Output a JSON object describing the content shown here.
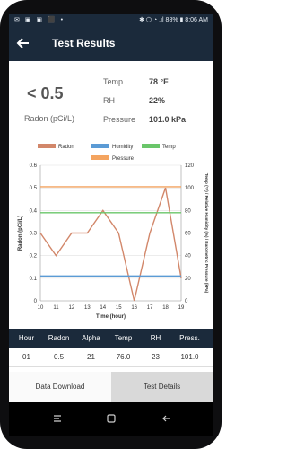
{
  "status_bar": {
    "left_icons": "✉ ▣ ▣ ⬛ •",
    "right_text": "✱ ⬡ ◔ .ıl 88% ▮ 8:06 AM"
  },
  "app_bar": {
    "back_icon": "back-arrow-icon",
    "title": "Test Results"
  },
  "summary": {
    "reading": "< 0.5",
    "unit": "Radon (pCi/L)",
    "metrics": [
      {
        "label": "Temp",
        "value": "78 °F"
      },
      {
        "label": "RH",
        "value": "22%"
      },
      {
        "label": "Pressure",
        "value": "101.0 kPa"
      }
    ]
  },
  "chart_data": {
    "type": "line",
    "legend": [
      {
        "name": "Radon",
        "color": "#d2876a"
      },
      {
        "name": "Humidity",
        "color": "#5b9bd5"
      },
      {
        "name": "Temp",
        "color": "#6ac66a"
      },
      {
        "name": "Pressure",
        "color": "#f4a460"
      }
    ],
    "x": [
      10,
      11,
      12,
      13,
      14,
      15,
      16,
      17,
      18,
      19
    ],
    "xlabel": "Time (hour)",
    "ylabel_left": "Radon (pCi/L)",
    "ylabel_right": "Temp (°F) / Relative Humidity (%) / Barometric Pressure (kPa)",
    "ylim_left": [
      0,
      0.6
    ],
    "ylim_right": [
      0,
      120
    ],
    "yticks_left": [
      "0",
      "0.1",
      "0.2",
      "0.3",
      "0.4",
      "0.5",
      "0.6"
    ],
    "yticks_right": [
      "0",
      "20",
      "40",
      "60",
      "80",
      "100",
      "120"
    ],
    "series": [
      {
        "name": "Radon",
        "axis": "left",
        "color": "#d2876a",
        "values": [
          0.3,
          0.2,
          0.3,
          0.3,
          0.4,
          0.3,
          0.0,
          0.3,
          0.5,
          0.1
        ]
      },
      {
        "name": "Humidity",
        "axis": "right",
        "color": "#5b9bd5",
        "values": [
          22,
          22,
          22,
          22,
          22,
          22,
          22,
          22,
          22,
          22
        ]
      },
      {
        "name": "Temp",
        "axis": "right",
        "color": "#6ac66a",
        "values": [
          78,
          78,
          78,
          78,
          78,
          78,
          78,
          78,
          78,
          78
        ]
      },
      {
        "name": "Pressure",
        "axis": "right",
        "color": "#f4a460",
        "values": [
          101,
          101,
          101,
          101,
          101,
          101,
          101,
          101,
          101,
          101
        ]
      }
    ]
  },
  "table": {
    "headers": [
      "Hour",
      "Radon",
      "Alpha",
      "Temp",
      "RH",
      "Press."
    ],
    "row": [
      "01",
      "0.5",
      "21",
      "76.0",
      "23",
      "101.0"
    ]
  },
  "tabs": {
    "download": "Data Download",
    "details": "Test Details"
  },
  "nav": {
    "recent_icon": "recent-apps-icon",
    "home_icon": "home-icon",
    "back_icon": "back-icon"
  }
}
